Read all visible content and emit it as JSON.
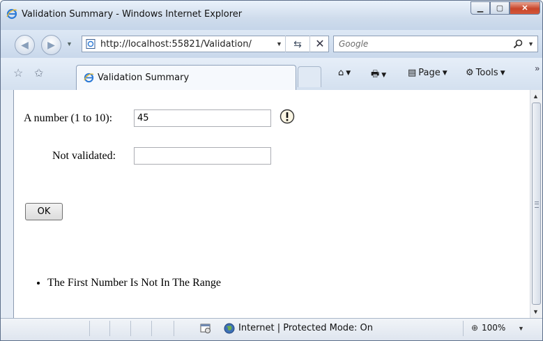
{
  "window": {
    "title": "Validation Summary - Windows Internet Explorer"
  },
  "nav": {
    "url": "http://localhost:55821/Validation/",
    "search_placeholder": "Google"
  },
  "tab": {
    "label": "Validation Summary"
  },
  "commands": {
    "page": "Page",
    "tools": "Tools"
  },
  "form": {
    "number_label": "A number (1 to 10):",
    "number_value": "45",
    "not_validated_label": "Not validated:",
    "not_validated_value": "",
    "ok_label": "OK"
  },
  "summary": {
    "errors": [
      "The First Number Is Not In The Range"
    ]
  },
  "status": {
    "zone": "Internet | Protected Mode: On",
    "zoom": "100%"
  },
  "icons": {
    "ie_logo": "ie-logo-icon",
    "warning": "warning-icon",
    "home": "home-icon",
    "print": "print-icon",
    "page": "page-icon",
    "tools": "gear-icon",
    "globe": "globe-icon"
  }
}
